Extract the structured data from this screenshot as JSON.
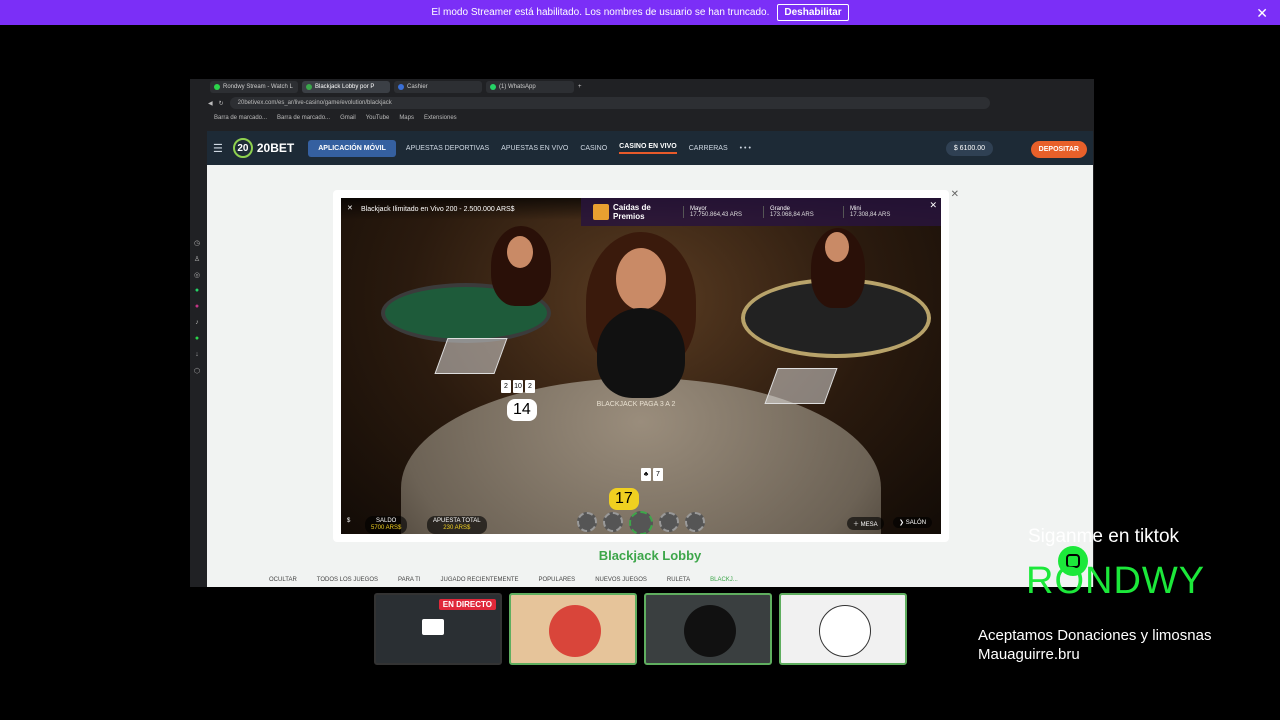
{
  "banner": {
    "message": "El modo Streamer está habilitado. Los nombres de usuario se han truncado.",
    "button": "Deshabilitar",
    "close": "✕"
  },
  "browser": {
    "tabs": [
      {
        "label": "Rondwy Stream - Watch L",
        "color": "#2bd44a"
      },
      {
        "label": "Blackjack Lobby por P",
        "color": "#3aa64a"
      },
      {
        "label": "Cashier",
        "color": "#3a6fd6"
      },
      {
        "label": "(1) WhatsApp",
        "color": "#25d366"
      }
    ],
    "new_tab": "+",
    "url": "20betivex.com/es_ar/live-casino/game/evolution/blackjack",
    "bookmarks": [
      "Barra de marcado...",
      "Barra de marcado...",
      "Gmail",
      "YouTube",
      "Maps",
      "Extensiones"
    ]
  },
  "site": {
    "logo": "20BET",
    "app_button": "APLICACIÓN MÓVIL",
    "nav": [
      "APUESTAS DEPORTIVAS",
      "APUESTAS EN VIVO",
      "CASINO",
      "CASINO EN VIVO",
      "CARRERAS"
    ],
    "more": "• • •",
    "region": "AR",
    "balance": "$ 6100.00",
    "deposit": "DEPOSITAR"
  },
  "game": {
    "title": "Blackjack Ilimitado en Vivo 200 - 2.500.000 ARS$",
    "prizes_heading": "Caídas de Premios",
    "prizes": [
      {
        "label": "Mayor",
        "value": "17.750.864,43 ARS"
      },
      {
        "label": "Grande",
        "value": "173.068,84 ARS"
      },
      {
        "label": "Mini",
        "value": "17.308,84 ARS"
      }
    ],
    "table_label": "BLACKJACK PAGA 3 A 2",
    "player_score": "14",
    "dealer_score": "17",
    "balance_label": "SALDO",
    "balance_value": "5700 ARS$",
    "bet_label": "APUESTA TOTAL",
    "bet_value": "230 ARS$",
    "table_button": "MESA",
    "lobby_button": "SALÓN"
  },
  "lobby": {
    "title": "Blackjack Lobby",
    "hide": "OCULTAR",
    "tabs": [
      "TODOS LOS JUEGOS",
      "PARA TI",
      "JUGADO RECIENTEMENTE",
      "POPULARES",
      "NUEVOS JUEGOS",
      "RULETA",
      "BLACKJ..."
    ]
  },
  "overlay": {
    "live_badge": "EN DIRECTO",
    "tiktok_text": "Siganme en tiktok",
    "handle": "RONDWY",
    "donate_line1": "Aceptamos Donaciones y limosnas",
    "donate_line2": "Mauaguirre.bru"
  }
}
